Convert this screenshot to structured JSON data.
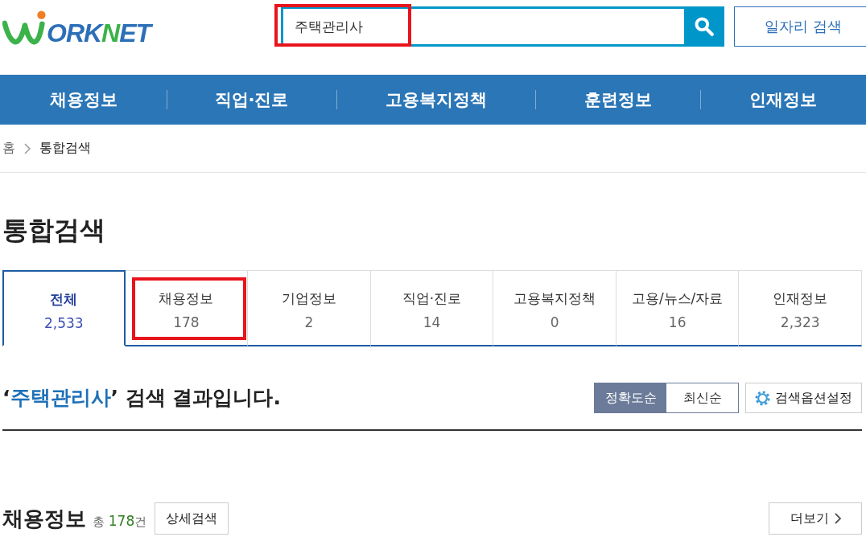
{
  "logo": {
    "parts": [
      {
        "text": "ORK",
        "color": "#2c6fb7"
      },
      {
        "text": "N",
        "color": "#3bb24a"
      },
      {
        "text": "ET",
        "color": "#2c6fb7"
      }
    ]
  },
  "search": {
    "value": "주택관리사",
    "highlighted": true
  },
  "job_search_button": "일자리 검색",
  "nav": [
    "채용정보",
    "직업·진로",
    "고용복지정책",
    "훈련정보",
    "인재정보"
  ],
  "breadcrumb": [
    "홈",
    "통합검색"
  ],
  "page_title": "통합검색",
  "tabs": [
    {
      "label": "전체",
      "count": "2,533",
      "selected": true,
      "highlighted": false
    },
    {
      "label": "채용정보",
      "count": "178",
      "selected": false,
      "highlighted": true
    },
    {
      "label": "기업정보",
      "count": "2",
      "selected": false,
      "highlighted": false
    },
    {
      "label": "직업·진로",
      "count": "14",
      "selected": false,
      "highlighted": false
    },
    {
      "label": "고용복지정책",
      "count": "0",
      "selected": false,
      "highlighted": false
    },
    {
      "label": "고용/뉴스/자료",
      "count": "16",
      "selected": false,
      "highlighted": false
    },
    {
      "label": "인재정보",
      "count": "2,323",
      "selected": false,
      "highlighted": false
    }
  ],
  "result_heading": {
    "before": "‘",
    "query": "주택관리사",
    "after": "’ 검색 결과입니다."
  },
  "sort_options": [
    {
      "label": "정확도순",
      "selected": true
    },
    {
      "label": "최신순",
      "selected": false
    }
  ],
  "options_button": "검색옵션설정",
  "section": {
    "title": "채용정보",
    "total_prefix": "총",
    "total_count": "178",
    "total_suffix": "건",
    "detail_button": "상세검색",
    "more_button": "더보기"
  }
}
